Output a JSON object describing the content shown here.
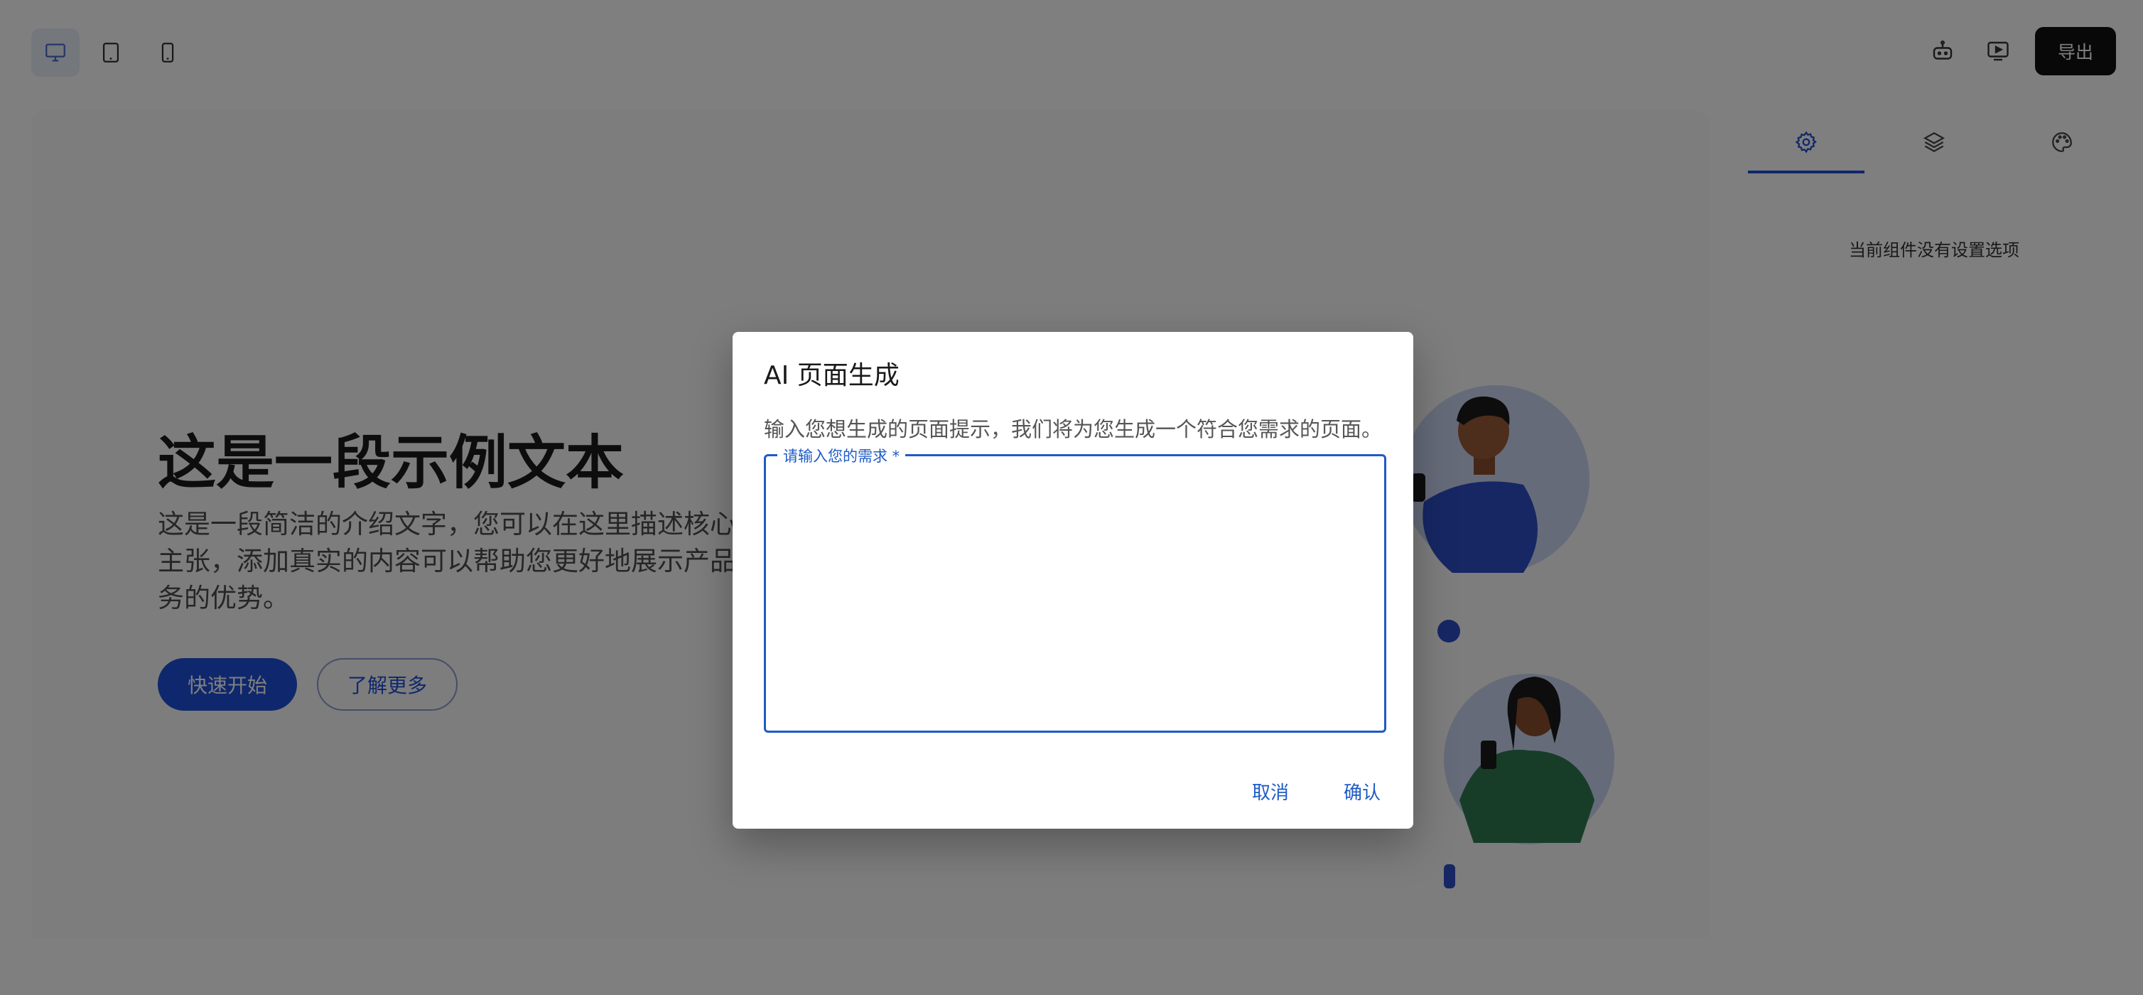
{
  "topbar": {
    "devices": [
      {
        "name": "desktop",
        "icon": "desktop-icon",
        "active": true
      },
      {
        "name": "tablet",
        "icon": "tablet-icon",
        "active": false
      },
      {
        "name": "mobile",
        "icon": "mobile-icon",
        "active": false
      }
    ],
    "ai_icon": "robot-icon",
    "preview_icon": "preview-icon",
    "export_label": "导出"
  },
  "hero": {
    "title": "这是一段示例文本",
    "description": "这是一段简洁的介绍文字，您可以在这里描述核心主张，添加真实的内容可以帮助您更好地展示产品务的优势。",
    "primary_button": "快速开始",
    "secondary_button": "了解更多"
  },
  "right_panel": {
    "tabs": [
      {
        "icon": "gear-icon",
        "active": true
      },
      {
        "icon": "layers-icon",
        "active": false
      },
      {
        "icon": "palette-icon",
        "active": false
      }
    ],
    "empty_message": "当前组件没有设置选项"
  },
  "dialog": {
    "title": "AI 页面生成",
    "description": "输入您想生成的页面提示，我们将为您生成一个符合您需求的页面。",
    "field_label": "请输入您的需求 *",
    "field_value": "",
    "cancel_label": "取消",
    "confirm_label": "确认"
  },
  "colors": {
    "accent": "#1e4fd8",
    "dialog_accent": "#1e5bc6",
    "export_bg": "#111111",
    "overlay": "rgba(0,0,0,0.5)"
  }
}
